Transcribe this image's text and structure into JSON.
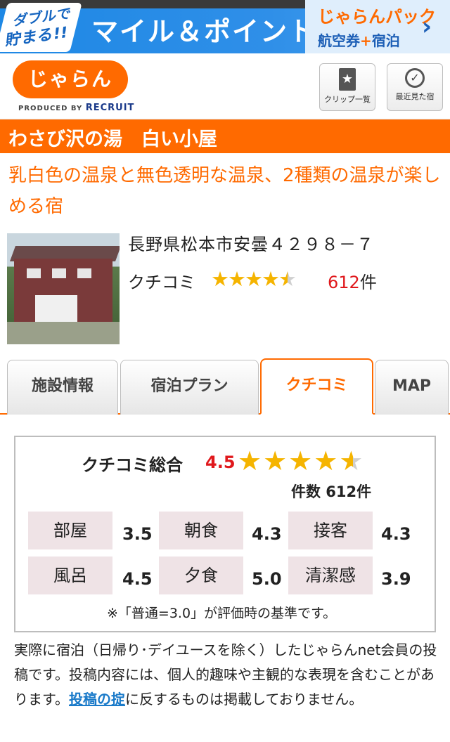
{
  "ad": {
    "badge_line1": "ダブルで",
    "badge_line2": "貯まる!!",
    "main": "マイル＆ポイント",
    "logo": "じゃらんパック",
    "sub_left": "航空券",
    "sub_plus": "+",
    "sub_right": "宿泊",
    "chevron": "›"
  },
  "header": {
    "logo_text": "じゃらん",
    "produced_by": "PRODUCED BY",
    "recruit": "RECRUIT",
    "clip_label": "クリップ一覧",
    "recent_label": "最近見た宿"
  },
  "hotel": {
    "name": "わさび沢の湯　白い小屋",
    "catch": "乳白色の温泉と無色透明な温泉、2種類の温泉が楽しめる宿",
    "address": "長野県松本市安曇４２９８－７",
    "review_label": "クチコミ",
    "review_count": "612",
    "review_count_unit": "件"
  },
  "tabs": [
    {
      "label": "施設情報"
    },
    {
      "label": "宿泊プラン"
    },
    {
      "label": "クチコミ"
    },
    {
      "label": "MAP"
    }
  ],
  "rating": {
    "title": "クチコミ総合",
    "score": "4.5",
    "count_label": "件数 612件",
    "items": [
      {
        "label": "部屋",
        "value": "3.5"
      },
      {
        "label": "朝食",
        "value": "4.3"
      },
      {
        "label": "接客",
        "value": "4.3"
      },
      {
        "label": "風呂",
        "value": "4.5"
      },
      {
        "label": "夕食",
        "value": "5.0"
      },
      {
        "label": "清潔感",
        "value": "3.9"
      }
    ],
    "note": "※「普通=3.0」が評価時の基準です。"
  },
  "disclaimer": {
    "before": "実際に宿泊（日帰り･デイユースを除く）したじゃらんnet会員の投稿です。投稿内容には、個人的趣味や主観的な表現を含むことがあります。",
    "link": "投稿の掟",
    "after": "に反するものは掲載しておりません。"
  },
  "colors": {
    "brand_orange": "#ff6a00",
    "score_red": "#e0181c",
    "star_gold": "#f5b400",
    "link_blue": "#1a7ac9"
  }
}
